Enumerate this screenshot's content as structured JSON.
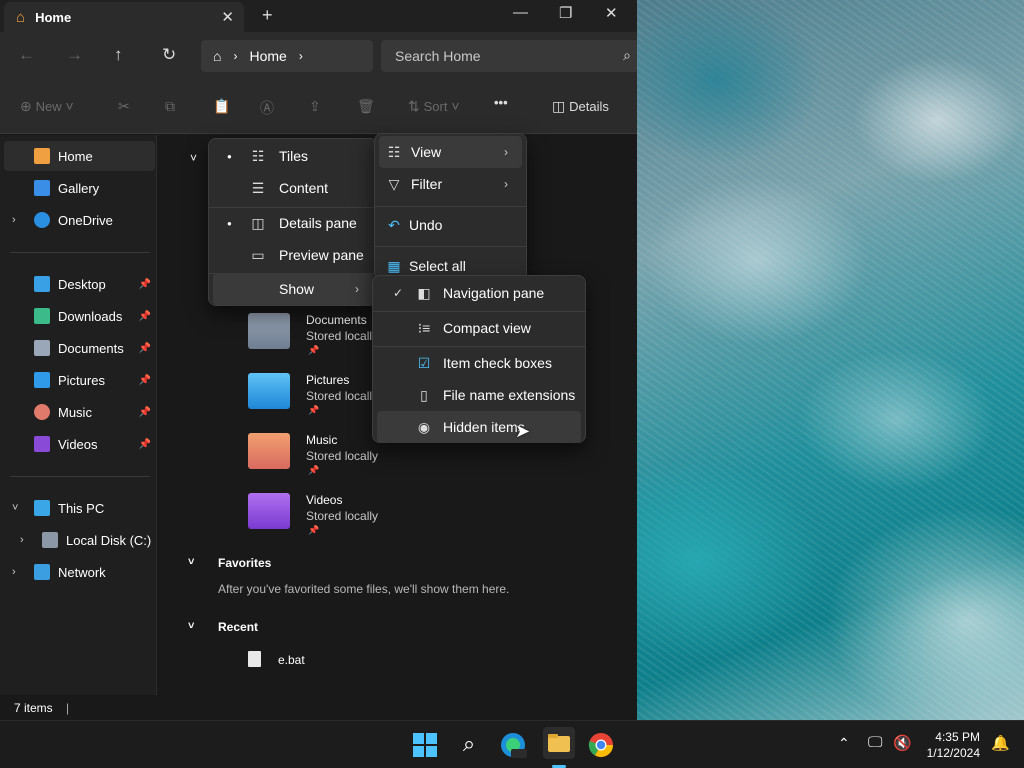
{
  "window": {
    "tab_title": "Home",
    "breadcrumb": [
      "Home"
    ],
    "search_placeholder": "Search Home"
  },
  "toolbar": {
    "new_label": "New",
    "sort_label": "Sort",
    "more_label": "•••",
    "details_label": "Details"
  },
  "sidebar": {
    "home": "Home",
    "gallery": "Gallery",
    "onedrive": "OneDrive",
    "desktop": "Desktop",
    "downloads": "Downloads",
    "documents": "Documents",
    "pictures": "Pictures",
    "music": "Music",
    "videos": "Videos",
    "thispc": "This PC",
    "localdisk": "Local Disk (C:)",
    "network": "Network"
  },
  "content": {
    "files": [
      {
        "name": "Documents",
        "sub": "Stored locally"
      },
      {
        "name": "Pictures",
        "sub": "Stored locally"
      },
      {
        "name": "Music",
        "sub": "Stored locally"
      },
      {
        "name": "Videos",
        "sub": "Stored locally"
      }
    ],
    "favorites_header": "Favorites",
    "favorites_empty": "After you've favorited some files, we'll show them here.",
    "recent_header": "Recent",
    "recent_file": "e.bat"
  },
  "status": {
    "items": "7 items"
  },
  "context_menu": {
    "view": "View",
    "filter": "Filter",
    "undo": "Undo",
    "select_all": "Select all"
  },
  "view_menu": {
    "tiles": "Tiles",
    "content": "Content",
    "details_pane": "Details pane",
    "preview_pane": "Preview pane",
    "show": "Show"
  },
  "show_menu": {
    "navigation_pane": "Navigation pane",
    "compact_view": "Compact view",
    "item_check_boxes": "Item check boxes",
    "file_name_extensions": "File name extensions",
    "hidden_items": "Hidden items"
  },
  "taskbar": {
    "time": "4:35 PM",
    "date": "1/12/2024"
  },
  "colors": {
    "accent": "#4cc2ff",
    "folder_yellow": "#f0c050"
  }
}
